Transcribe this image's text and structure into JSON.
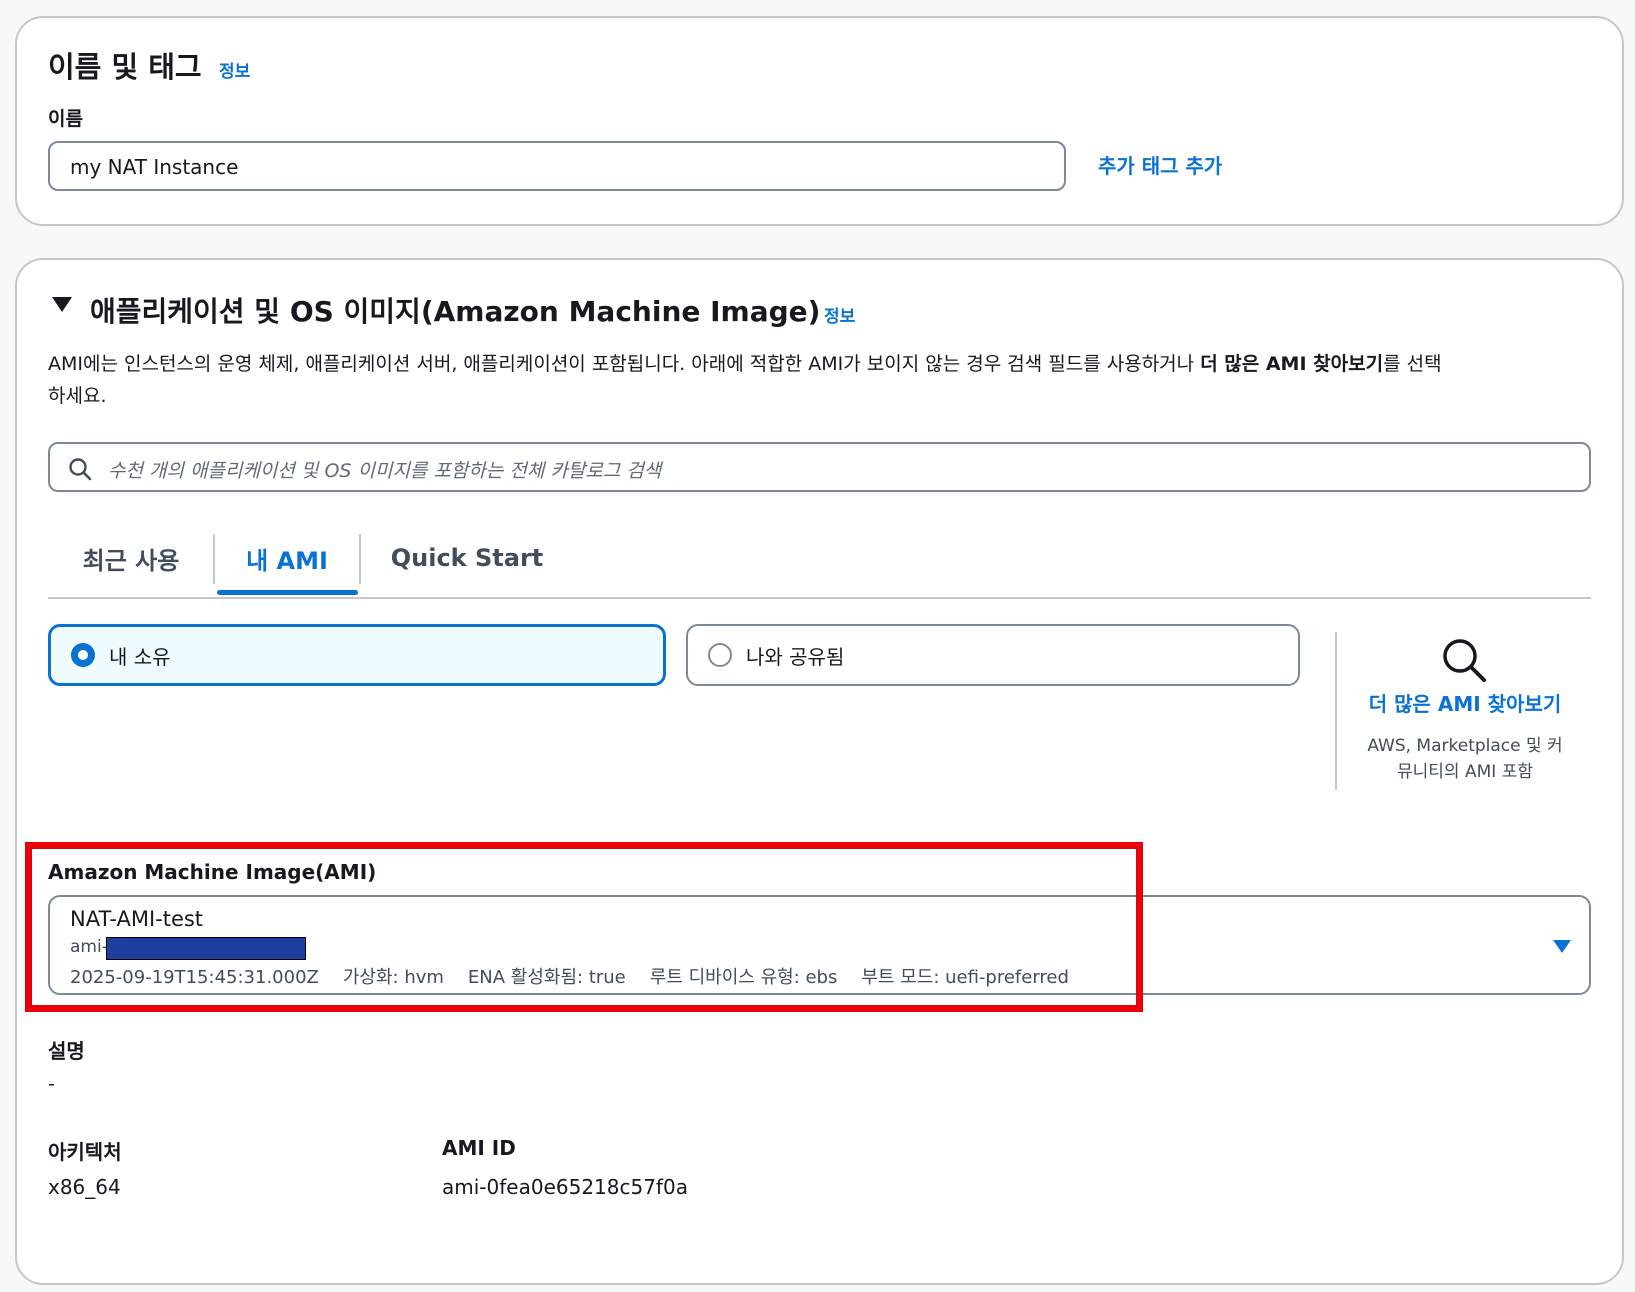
{
  "tags_section": {
    "title": "이름 및 태그",
    "info": "정보",
    "name_label": "이름",
    "name_value": "my NAT Instance",
    "add_tag": "추가 태그 추가"
  },
  "ami_section": {
    "title": "애플리케이션 및 OS 이미지(Amazon Machine Image)",
    "info": "정보",
    "description_part1": "AMI에는 인스턴스의 운영 체제, 애플리케이션 서버, 애플리케이션이 포함됩니다. 아래에 적합한 AMI가 보이지 않는 경우 검색 필드를 사용하거나 ",
    "description_bold": "더 많은 AMI 찾아보기",
    "description_part2": "를 선택",
    "description_line2": "하세요.",
    "search_placeholder": "수천 개의 애플리케이션 및 OS 이미지를 포함하는 전체 카탈로그 검색",
    "tabs": [
      {
        "label": "최근 사용",
        "active": false
      },
      {
        "label": "내 AMI",
        "active": true
      },
      {
        "label": "Quick Start",
        "active": false
      }
    ],
    "ownership_options": [
      {
        "label": "내 소유",
        "selected": true
      },
      {
        "label": "나와 공유됨",
        "selected": false
      }
    ],
    "browse_more": {
      "link": "더 많은 AMI 찾아보기",
      "caption_line1": "AWS, Marketplace 및 커",
      "caption_line2": "뮤니티의 AMI 포함"
    },
    "ami_select": {
      "label": "Amazon Machine Image(AMI)",
      "name": "NAT-AMI-test",
      "id_prefix": "ami-",
      "created": "2025-09-19T15:45:31.000Z",
      "virtualization": "가상화: hvm",
      "ena": "ENA 활성화됨: true",
      "root_device": "루트 디바이스 유형: ebs",
      "boot_mode": "부트 모드: uefi-preferred"
    },
    "description_label": "설명",
    "description_value": "-",
    "architecture_label": "아키텍처",
    "architecture_value": "x86_64",
    "ami_id_label": "AMI ID",
    "ami_id_value": "ami-0fea0e65218c57f0a"
  },
  "colors": {
    "accent": "#0972d3",
    "highlight_border": "#e8000b",
    "redaction": "#1f3fa0",
    "selected_card_bg": "#f0fbff"
  }
}
